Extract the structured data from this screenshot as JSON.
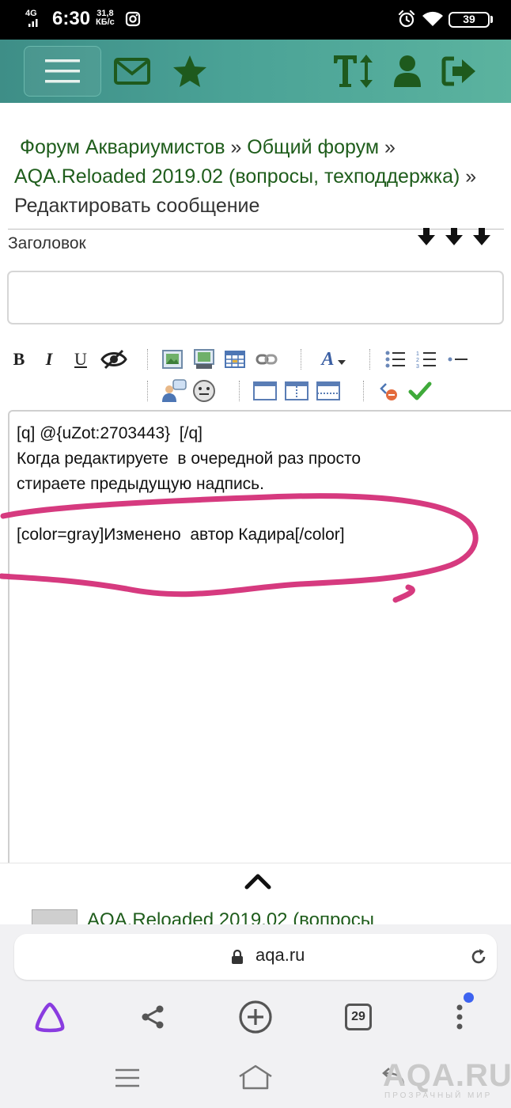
{
  "status_bar": {
    "network": "4G",
    "time": "6:30",
    "speed_value": "31,8",
    "speed_unit": "КБ/с",
    "battery": "39"
  },
  "header": {
    "icons": [
      "menu-icon",
      "mail-icon",
      "star-icon",
      "text-size-icon",
      "user-icon",
      "logout-icon"
    ],
    "accent_color": "#1e5a1d"
  },
  "breadcrumb": {
    "link1": "Форум Аквариумистов",
    "sep1": " » ",
    "link2": "Общий форум",
    "sep2": " » ",
    "link3": "AQA.Reloaded 2019.02 (вопросы, техподдержка)",
    "sep3": " » ",
    "current": "Редактировать сообщение"
  },
  "form": {
    "title_label": "Заголовок",
    "title_value": ""
  },
  "toolbar": {
    "bold": "B",
    "italic": "I",
    "underline": "U",
    "font_color": "A"
  },
  "editor": {
    "line1": "[q] @{uZot:2703443}  [/q]",
    "line2": "Когда редактируете  в очередной раз просто",
    "line3": "стираете предыдущую надпись.",
    "line4": "[color=gray]Изменено  автор Кадира[/color]"
  },
  "recent": {
    "title": "AQA.Reloaded 2019.02 (вопросы"
  },
  "browser": {
    "url": "aqa.ru",
    "tabs_count": "29"
  },
  "watermark": {
    "brand": "AQA.RU",
    "tagline": "ПРОЗРАЧНЫЙ МИР"
  },
  "colors": {
    "header_gradient_start": "#3e8e87",
    "header_gradient_end": "#5bb39f",
    "link_green": "#1f5d1c",
    "annotation_pink": "#d63a7f"
  }
}
